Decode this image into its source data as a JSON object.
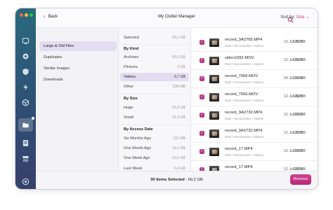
{
  "window": {
    "title": "My Clutter Manager",
    "back_label": "Back",
    "sort_label": "Sort by:",
    "sort_value": "Size"
  },
  "colors": {
    "accent": "#c0317c",
    "sidebar_top": "#2a6a7d",
    "sidebar_bottom": "#37406b",
    "selection": "#e2ddf0"
  },
  "rail_icons": [
    "smart-scan-icon",
    "cleanup-icon",
    "protection-icon",
    "performance-icon",
    "applications-icon",
    "my-clutter-icon",
    "files-icon",
    "shredder-icon",
    "assistant-icon"
  ],
  "categories": [
    "Large & Old Files",
    "Duplicates",
    "Similar Images",
    "Downloads"
  ],
  "filters": {
    "selected": {
      "label": "Selected",
      "size": "69,2 GB"
    },
    "by_kind_heading": "By Kind",
    "by_kind": [
      {
        "label": "Archives",
        "size": "63,9 GB"
      },
      {
        "label": "Pictures",
        "size": "2 GB"
      },
      {
        "label": "Videos",
        "size": "6,7 GB"
      },
      {
        "label": "Other",
        "size": "535 MB"
      }
    ],
    "by_size_heading": "By Size",
    "by_size": [
      {
        "label": "Huge",
        "size": "61,8 GB"
      },
      {
        "label": "Small",
        "size": "11,4 GB"
      }
    ],
    "by_access_heading": "By Access Date",
    "by_access": [
      {
        "label": "Six Months Ago",
        "size": "231 MB"
      },
      {
        "label": "One Month Ago",
        "size": "11,5 GB"
      },
      {
        "label": "One Week Ago",
        "size": "23,5 GB"
      },
      {
        "label": "Last Week",
        "size": "6,4 GB"
      }
    ]
  },
  "files": [
    {
      "name": "record_3A2765.MP4",
      "path": "Raei • Documents • Videos",
      "date": "12 Jul 2025",
      "size": "135 MB",
      "checked": "✓"
    },
    {
      "name": "video1092.MOV",
      "path": "Raei • Documents • Videos",
      "date": "12 Jul 2025",
      "size": "155 MB",
      "checked": "✓"
    },
    {
      "name": "record_7066.MOV",
      "path": "Raei • Documents • Videos",
      "date": "24 Jul 2025",
      "size": "214 MB",
      "checked": "✓"
    },
    {
      "name": "record_7066.MOV",
      "path": "Raei • Documents • Videos",
      "date": "12 Jul 2025",
      "size": "148 MB",
      "checked": "✓"
    },
    {
      "name": "record_3A2732.MP4",
      "path": "Raei • Documents • Videos",
      "date": "12 Jul 2025",
      "size": "169 MB",
      "checked": "✓"
    },
    {
      "name": "record_3A2732.MP4",
      "path": "Raei • Documents • Videos",
      "date": "12 Jul 2025",
      "size": "135 MB",
      "checked": "✓"
    },
    {
      "name": "record_17.MP4",
      "path": "Raei • Documents • Videos",
      "date": "12 Jul 2025",
      "size": "169 MB",
      "checked": "✓"
    },
    {
      "name": "record_17.MP4",
      "path": "Raei • Documents • Videos",
      "date": "12 Jul 2025",
      "size": "169 MB",
      "checked": "✓"
    }
  ],
  "footer": {
    "count": "30 Items Selected",
    "separator": "|",
    "total": "69,2 GB",
    "remove_label": "Remove"
  }
}
